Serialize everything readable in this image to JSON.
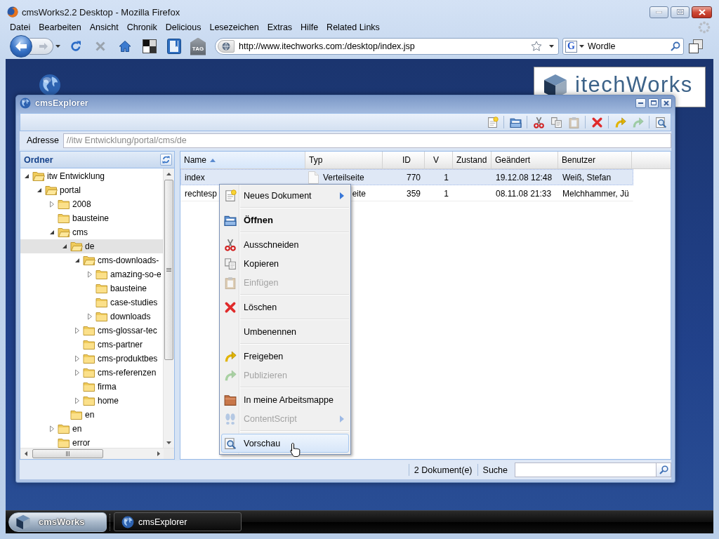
{
  "browser": {
    "title": "cmsWorks2.2 Desktop - Mozilla Firefox",
    "menu": [
      "Datei",
      "Bearbeiten",
      "Ansicht",
      "Chronik",
      "Delicious",
      "Lesezeichen",
      "Extras",
      "Hilfe",
      "Related Links"
    ],
    "navigation": {
      "back_disabled": false,
      "forward_disabled": true,
      "tag_label": "TAG",
      "url": "http://www.itechworks.com:/desktop/index.jsp",
      "search_engine": "G",
      "search_value": "Wordle"
    }
  },
  "desktop": {
    "logo": "itechWorks"
  },
  "explorer": {
    "title": "cmsExplorer",
    "toolbar": [
      [
        {
          "kind": "new",
          "disabled": false
        }
      ],
      [
        {
          "kind": "open",
          "disabled": false
        }
      ],
      [
        {
          "kind": "cut",
          "disabled": false
        },
        {
          "kind": "copy",
          "disabled": false
        },
        {
          "kind": "paste",
          "disabled": true
        }
      ],
      [
        {
          "kind": "delete",
          "disabled": false
        }
      ],
      [
        {
          "kind": "release",
          "disabled": false
        },
        {
          "kind": "publish",
          "disabled": true
        }
      ],
      [
        {
          "kind": "preview",
          "disabled": false
        }
      ]
    ],
    "address": {
      "label": "Adresse",
      "value": "//itw Entwicklung/portal/cms/de"
    },
    "folders": {
      "title": "Ordner",
      "tree": [
        {
          "label": "itw Entwicklung",
          "kind": "branch",
          "expanded": true,
          "selected": false,
          "children": [
            {
              "label": "portal",
              "kind": "branch",
              "expanded": true,
              "selected": false,
              "children": [
                {
                  "label": "2008",
                  "kind": "branch",
                  "expanded": false,
                  "selected": false
                },
                {
                  "label": "bausteine",
                  "kind": "leaf",
                  "expanded": false,
                  "selected": false
                },
                {
                  "label": "cms",
                  "kind": "branch",
                  "expanded": true,
                  "selected": false,
                  "children": [
                    {
                      "label": "de",
                      "kind": "branch",
                      "expanded": true,
                      "selected": true,
                      "children": [
                        {
                          "label": "cms-downloads-",
                          "kind": "branch",
                          "expanded": true,
                          "selected": false,
                          "children": [
                            {
                              "label": "amazing-so-e",
                              "kind": "branch",
                              "expanded": false,
                              "selected": false
                            },
                            {
                              "label": "bausteine",
                              "kind": "leaf",
                              "expanded": false,
                              "selected": false
                            },
                            {
                              "label": "case-studies",
                              "kind": "leaf",
                              "expanded": false,
                              "selected": false
                            },
                            {
                              "label": "downloads",
                              "kind": "branch",
                              "expanded": false,
                              "selected": false
                            }
                          ]
                        },
                        {
                          "label": "cms-glossar-tec",
                          "kind": "branch",
                          "expanded": false,
                          "selected": false
                        },
                        {
                          "label": "cms-partner",
                          "kind": "leaf",
                          "expanded": false,
                          "selected": false
                        },
                        {
                          "label": "cms-produktbes",
                          "kind": "branch",
                          "expanded": false,
                          "selected": false
                        },
                        {
                          "label": "cms-referenzen",
                          "kind": "branch",
                          "expanded": false,
                          "selected": false
                        },
                        {
                          "label": "firma",
                          "kind": "leaf",
                          "expanded": false,
                          "selected": false
                        },
                        {
                          "label": "home",
                          "kind": "branch",
                          "expanded": false,
                          "selected": false
                        }
                      ]
                    },
                    {
                      "label": "en",
                      "kind": "leaf",
                      "expanded": false,
                      "selected": false
                    }
                  ]
                },
                {
                  "label": "en",
                  "kind": "branch",
                  "expanded": false,
                  "selected": false
                },
                {
                  "label": "error",
                  "kind": "leaf",
                  "expanded": false,
                  "selected": false
                }
              ]
            }
          ]
        }
      ]
    },
    "table": {
      "columns": [
        {
          "label": "Name",
          "kind": "text",
          "sorted": true
        },
        {
          "label": "Typ",
          "kind": "text",
          "sorted": false
        },
        {
          "label": "ID",
          "kind": "number",
          "sorted": false
        },
        {
          "label": "V",
          "kind": "number",
          "sorted": false
        },
        {
          "label": "Zustand",
          "kind": "text",
          "sorted": false
        },
        {
          "label": "Geändert",
          "kind": "text",
          "sorted": false
        },
        {
          "label": "Benutzer",
          "kind": "text",
          "sorted": false
        }
      ],
      "rows": [
        {
          "selected": true,
          "type_icon": true,
          "cells": [
            "index",
            "Verteilseite",
            "770",
            "1",
            null,
            "19.12.08 12:48",
            "Weiß, Stefan"
          ]
        },
        {
          "selected": false,
          "type_icon": false,
          "cells": [
            "rechtesp",
            "eite",
            "359",
            "1",
            null,
            "08.11.08 21:33",
            "Melchhammer, Jü"
          ]
        }
      ]
    },
    "status": {
      "count": "2 Dokument(e)",
      "search_label": "Suche"
    }
  },
  "context_menu": {
    "groups": [
      [
        {
          "label": "Neues Dokument",
          "kind": "new",
          "default": false,
          "disabled": false,
          "submenu": true,
          "selected": false
        }
      ],
      [
        {
          "label": "Öffnen",
          "kind": "open",
          "default": true,
          "disabled": false,
          "submenu": false,
          "selected": false
        }
      ],
      [
        {
          "label": "Ausschneiden",
          "kind": "cut",
          "default": false,
          "disabled": false,
          "submenu": false,
          "selected": false
        },
        {
          "label": "Kopieren",
          "kind": "copy",
          "default": false,
          "disabled": false,
          "submenu": false,
          "selected": false
        },
        {
          "label": "Einfügen",
          "kind": "paste",
          "default": false,
          "disabled": true,
          "submenu": false,
          "selected": false
        }
      ],
      [
        {
          "label": "Löschen",
          "kind": "delete",
          "default": false,
          "disabled": false,
          "submenu": false,
          "selected": false
        }
      ],
      [
        {
          "label": "Umbenennen",
          "kind": "rename",
          "default": false,
          "disabled": false,
          "submenu": false,
          "selected": false
        }
      ],
      [
        {
          "label": "Freigeben",
          "kind": "release",
          "default": false,
          "disabled": false,
          "submenu": false,
          "selected": false
        },
        {
          "label": "Publizieren",
          "kind": "publish",
          "default": false,
          "disabled": true,
          "submenu": false,
          "selected": false
        }
      ],
      [
        {
          "label": "In meine Arbeitsmappe",
          "kind": "workspace",
          "default": false,
          "disabled": false,
          "submenu": false,
          "selected": false
        },
        {
          "label": "ContentScript",
          "kind": "script",
          "default": false,
          "disabled": true,
          "submenu": true,
          "selected": false
        }
      ],
      [
        {
          "label": "Vorschau",
          "kind": "preview",
          "default": false,
          "disabled": false,
          "submenu": false,
          "selected": true
        }
      ]
    ]
  },
  "taskbar": {
    "start": "cmsWorks",
    "tasks": [
      {
        "label": "cmsExplorer"
      }
    ]
  }
}
